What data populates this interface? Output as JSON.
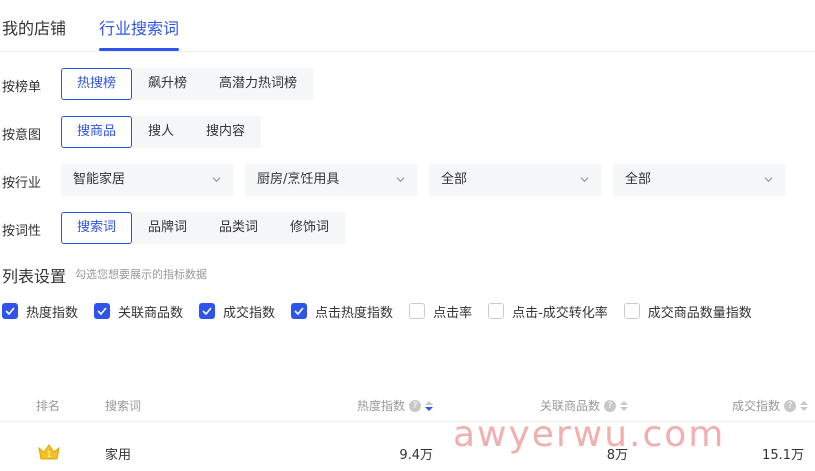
{
  "tabs": [
    {
      "label": "我的店铺",
      "active": false
    },
    {
      "label": "行业搜索词",
      "active": true
    }
  ],
  "filters": {
    "ranking": {
      "label": "按榜单",
      "options": [
        "热搜榜",
        "飙升榜",
        "高潜力热词榜"
      ],
      "active": "热搜榜"
    },
    "intent": {
      "label": "按意图",
      "options": [
        "搜商品",
        "搜人",
        "搜内容"
      ],
      "active": "搜商品"
    },
    "industry": {
      "label": "按行业",
      "selects": [
        "智能家居",
        "厨房/烹饪用具",
        "全部",
        "全部"
      ]
    },
    "word_type": {
      "label": "按词性",
      "options": [
        "搜索词",
        "品牌词",
        "品类词",
        "修饰词"
      ],
      "active": "搜索词"
    }
  },
  "list_settings": {
    "title": "列表设置",
    "hint": "勾选您想要展示的指标数据",
    "metrics": [
      {
        "label": "热度指数",
        "checked": true
      },
      {
        "label": "关联商品数",
        "checked": true
      },
      {
        "label": "成交指数",
        "checked": true
      },
      {
        "label": "点击热度指数",
        "checked": true
      },
      {
        "label": "点击率",
        "checked": false
      },
      {
        "label": "点击-成交转化率",
        "checked": false
      },
      {
        "label": "成交商品数量指数",
        "checked": false
      }
    ]
  },
  "table": {
    "columns": {
      "rank": "排名",
      "keyword": "搜索词",
      "heat": "热度指数",
      "products": "关联商品数",
      "deals": "成交指数"
    },
    "rows": [
      {
        "rank_icon": "gold-crown-icon",
        "keyword": "家用",
        "heat": "9.4万",
        "products": "8万",
        "deals": "15.1万"
      }
    ]
  },
  "watermark": "awyerwu.com",
  "colors": {
    "accent": "#2f54eb",
    "watermark": "#e96c6c"
  }
}
